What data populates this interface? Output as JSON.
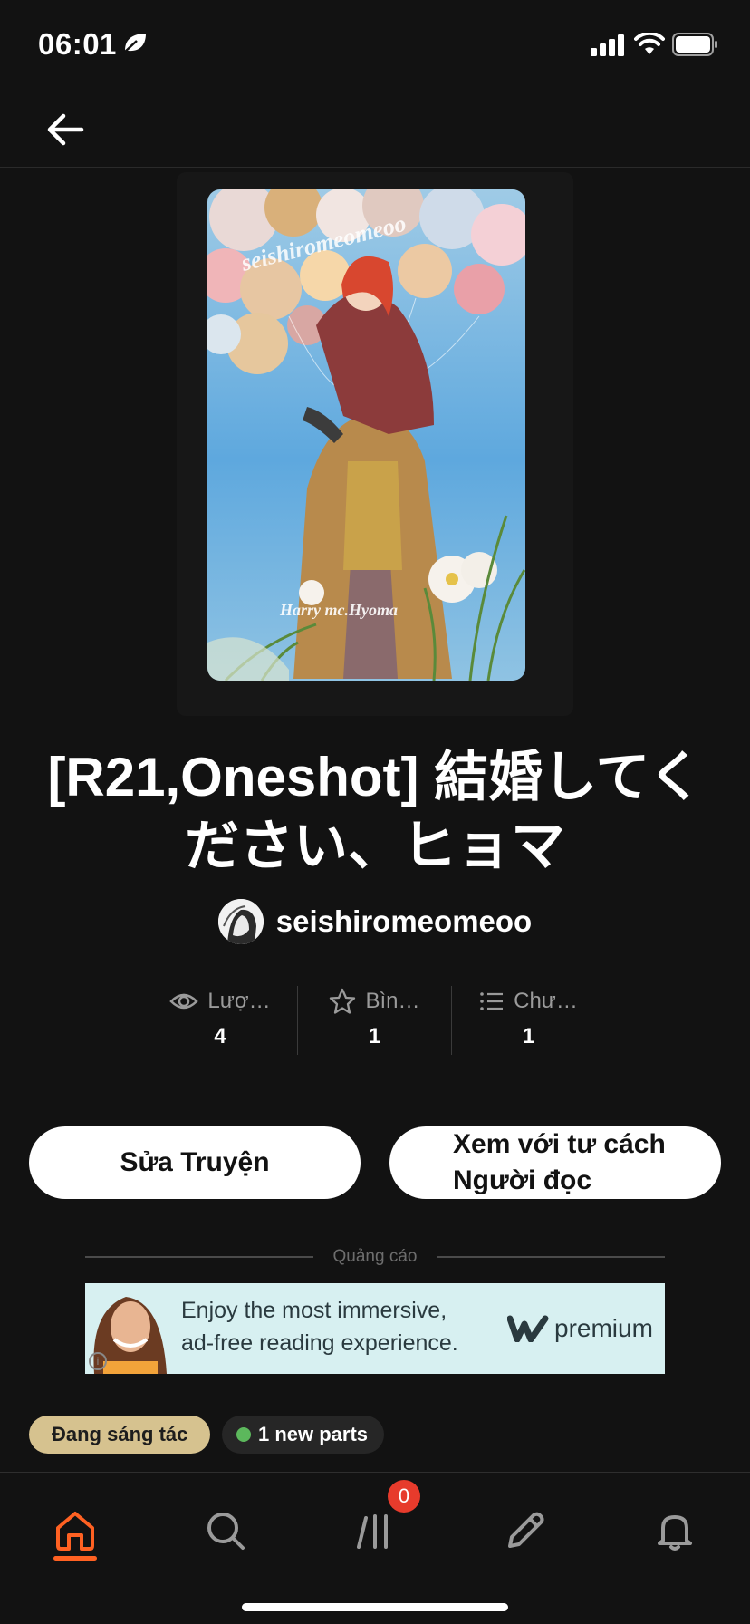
{
  "status_bar": {
    "time": "06:01"
  },
  "story": {
    "title": "[R21,Oneshot] 結婚してください、ヒョマ",
    "author": "seishiromeomeoo",
    "cover_text_top": "seishiromeomeoo",
    "cover_text_bottom": "Harry mc.Hyoma"
  },
  "stats": [
    {
      "label": "Lượ…",
      "value": "4",
      "icon": "eye-icon"
    },
    {
      "label": "Bìn…",
      "value": "1",
      "icon": "star-icon"
    },
    {
      "label": "Chư…",
      "value": "1",
      "icon": "list-icon"
    }
  ],
  "actions": {
    "edit_label": "Sửa Truyện",
    "reader_line1": "Xem với tư cách",
    "reader_line2": "Người đọc"
  },
  "ad": {
    "label": "Quảng cáo",
    "line1": "Enjoy the most immersive,",
    "line2": "ad-free reading experience.",
    "brand": "premium"
  },
  "tags": {
    "status": "Đang sáng tác",
    "new_parts": "1 new parts"
  },
  "nav": {
    "library_badge": "0"
  },
  "colors": {
    "background": "#121212",
    "accent": "#ff6122",
    "status_tag": "#d6c28f",
    "badge": "#e73b2c"
  }
}
